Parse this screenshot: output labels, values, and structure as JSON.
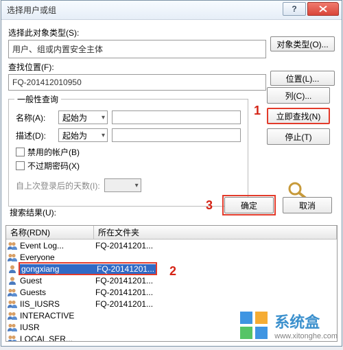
{
  "window": {
    "title": "选择用户或组"
  },
  "object_type": {
    "label": "选择此对象类型(S):",
    "value": "用户、组或内置安全主体",
    "button": "对象类型(O)..."
  },
  "location": {
    "label": "查找位置(F):",
    "value": "FQ-201412010950",
    "button": "位置(L)..."
  },
  "general_query": {
    "legend": "一般性查询",
    "name_label": "名称(A):",
    "name_mode": "起始为",
    "desc_label": "描述(D):",
    "desc_mode": "起始为",
    "disabled_accounts": "禁用的帐户(B)",
    "nonexpiring_pw": "不过期密码(X)",
    "days_since_login": "自上次登录后的天数(I):"
  },
  "side": {
    "columns_btn": "列(C)...",
    "find_now_btn": "立即查找(N)",
    "stop_btn": "停止(T)"
  },
  "actions": {
    "ok": "确定",
    "cancel": "取消"
  },
  "results": {
    "label": "搜索结果(U):",
    "col_name": "名称(RDN)",
    "col_folder": "所在文件夹",
    "rows": [
      {
        "name": "Event Log...",
        "folder": "FQ-20141201...",
        "icon": "group"
      },
      {
        "name": "Everyone",
        "folder": "",
        "icon": "group"
      },
      {
        "name": "gongxiang",
        "folder": "FQ-20141201...",
        "icon": "user",
        "selected": true
      },
      {
        "name": "Guest",
        "folder": "FQ-20141201...",
        "icon": "user"
      },
      {
        "name": "Guests",
        "folder": "FQ-20141201...",
        "icon": "group"
      },
      {
        "name": "IIS_IUSRS",
        "folder": "FQ-20141201...",
        "icon": "group"
      },
      {
        "name": "INTERACTIVE",
        "folder": "",
        "icon": "group"
      },
      {
        "name": "IUSR",
        "folder": "",
        "icon": "group"
      },
      {
        "name": "LOCAL SER...",
        "folder": "",
        "icon": "group"
      }
    ]
  },
  "markers": {
    "m1": "1",
    "m2": "2",
    "m3": "3"
  },
  "watermark": {
    "brand": "系统盒",
    "url": "www.xitonghe.com"
  }
}
